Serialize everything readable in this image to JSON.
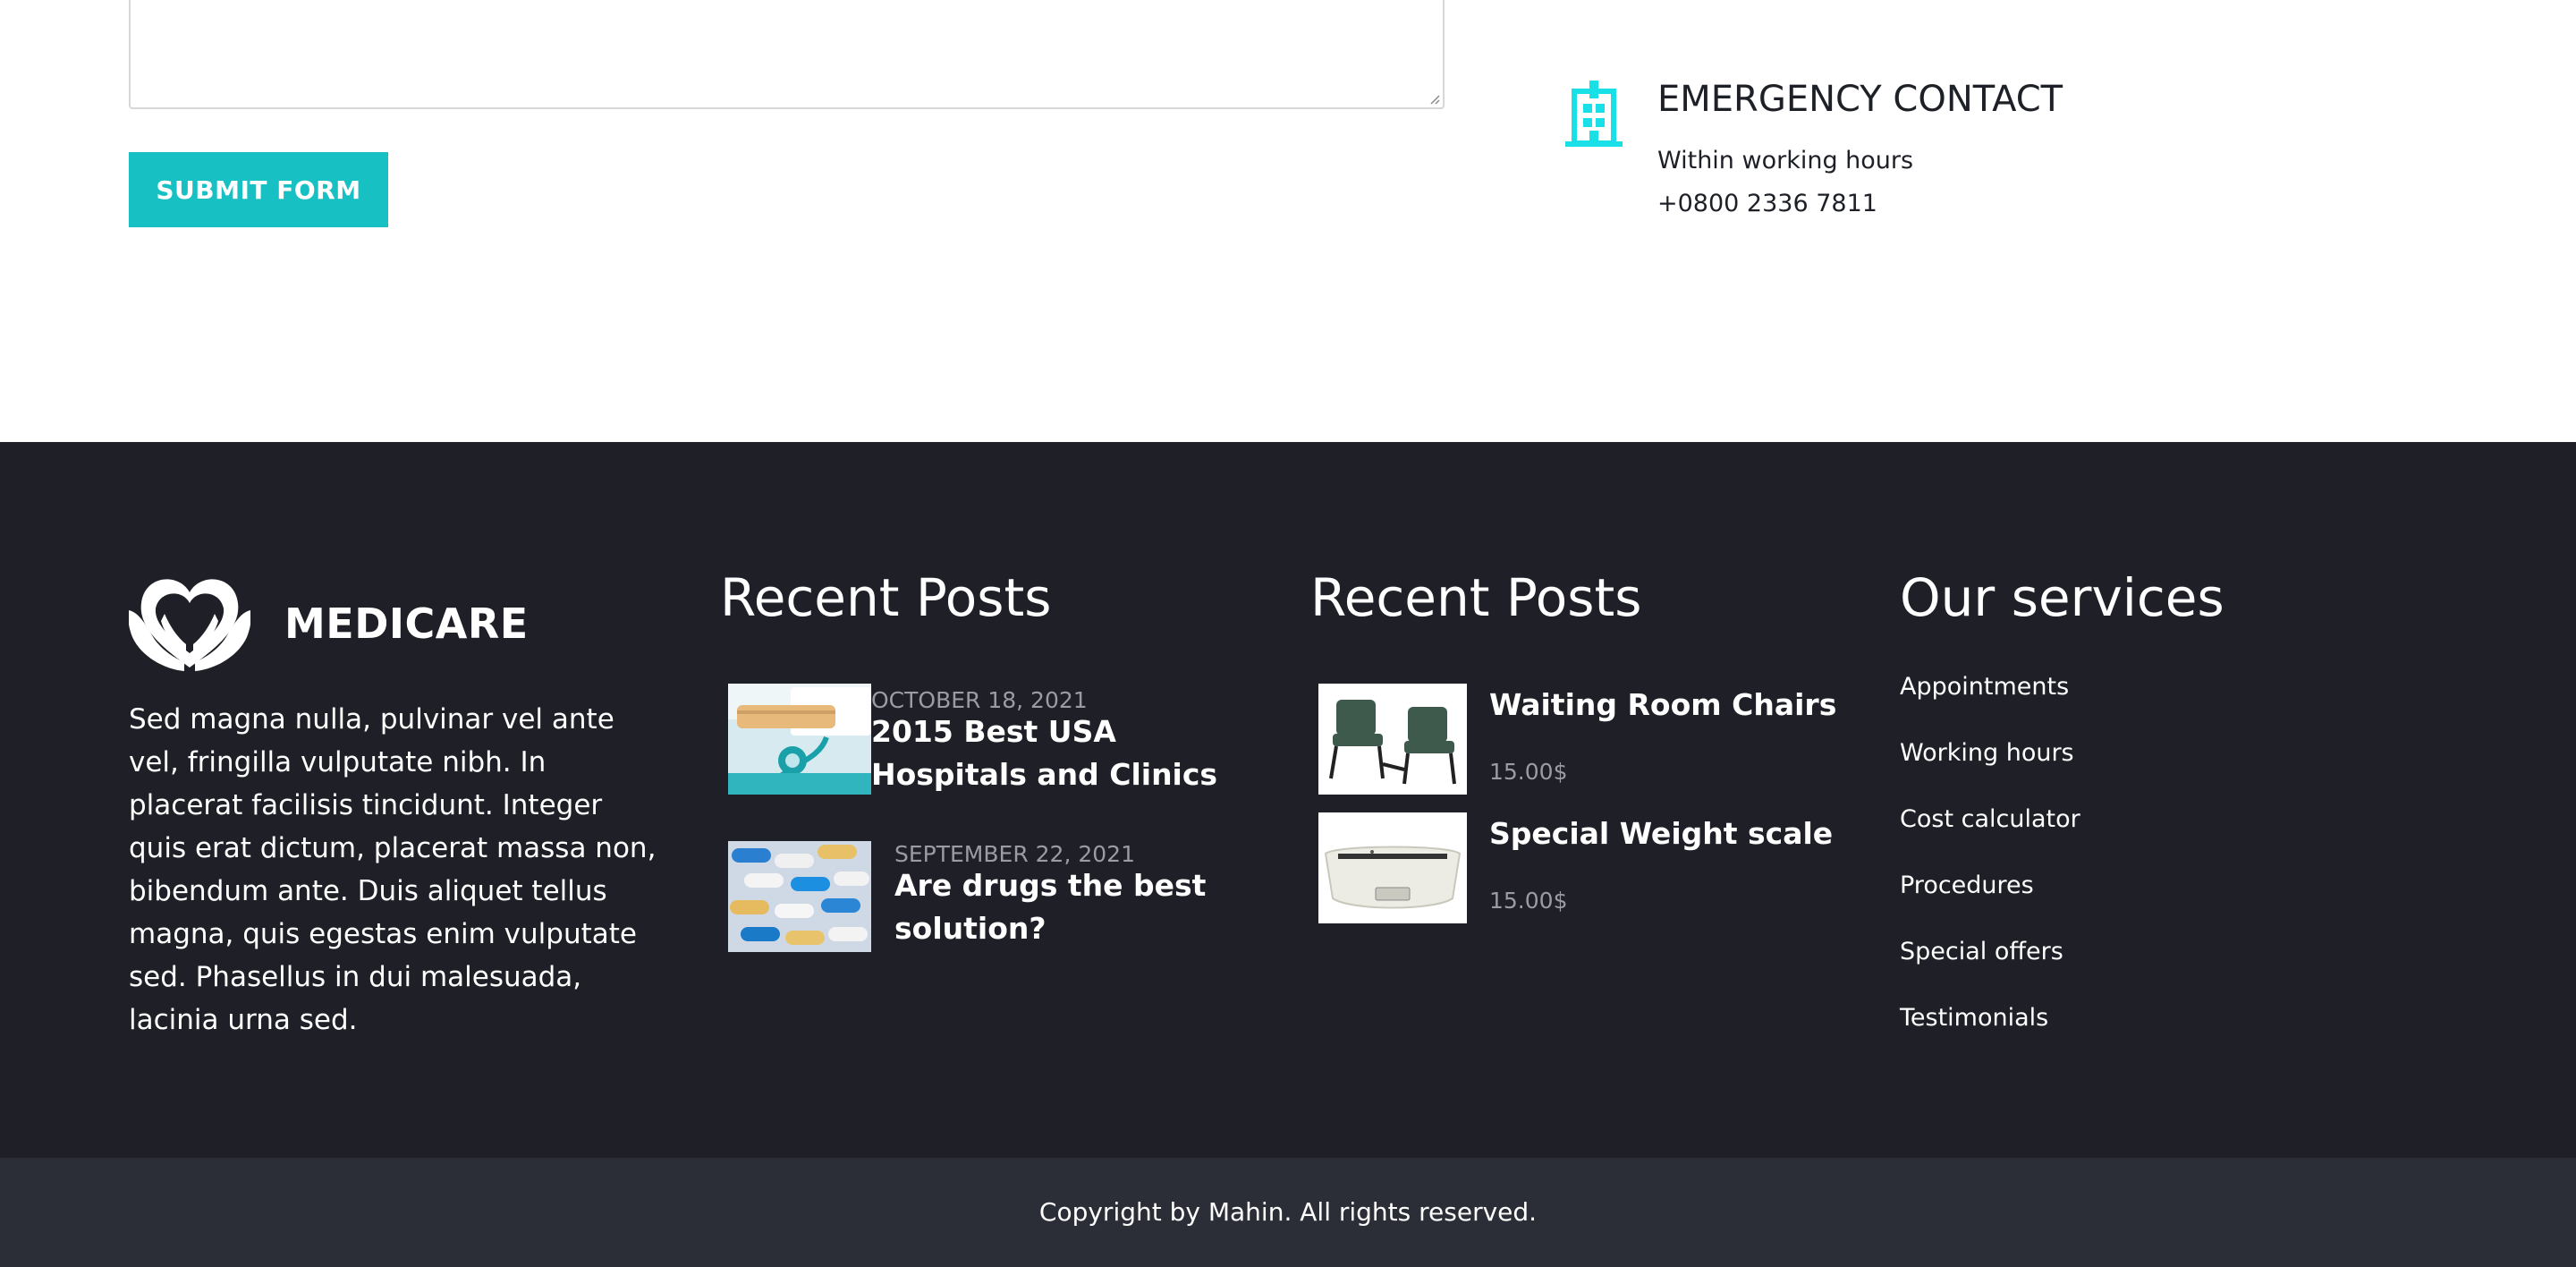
{
  "contact_form": {
    "message_value": "",
    "submit_label": "SUBMIT FORM"
  },
  "emergency": {
    "title": "EMERGENCY CONTACT",
    "line1": "Within working hours",
    "line2": "+0800 2336 7811",
    "icon": "hospital-building-icon",
    "icon_color": "#19e0e6"
  },
  "footer": {
    "logo": {
      "text": "MEDICARE",
      "icon": "heart-hands-logo"
    },
    "about": "Sed magna nulla, pulvinar vel ante vel, fringilla vulputate nibh. In placerat facilisis tincidunt. Integer quis erat dictum, placerat massa non, bibendum ante. Duis aliquet tellus magna, quis egestas enim vulputate sed. Phasellus in dui malesuada, lacinia urna sed.",
    "recent_posts": {
      "title": "Recent Posts",
      "items": [
        {
          "date": "OCTOBER 18, 2021",
          "title": "2015 Best USA Hospitals and Clinics",
          "image": "stethoscope-and-pills-photo"
        },
        {
          "date": "SEPTEMBER 22, 2021",
          "title": "Are drugs the best solution?",
          "image": "capsules-photo"
        }
      ]
    },
    "recent_products": {
      "title": "Recent Posts",
      "items": [
        {
          "title": "Waiting Room Chairs",
          "price": "15.00$",
          "image": "waiting-chairs-photo"
        },
        {
          "title": "Special Weight scale",
          "price": "15.00$",
          "image": "baby-weight-scale-photo"
        }
      ]
    },
    "services": {
      "title": "Our services",
      "items": [
        "Appointments",
        "Working hours",
        "Cost calculator",
        "Procedures",
        "Special offers",
        "Testimonials"
      ]
    },
    "copyright": "Copyright by Mahin. All rights reserved."
  },
  "colors": {
    "accent": "#17c0c2",
    "footer_bg": "#1f2027",
    "copyright_bg": "#2c2e37",
    "muted_text": "#9a9ca5"
  }
}
